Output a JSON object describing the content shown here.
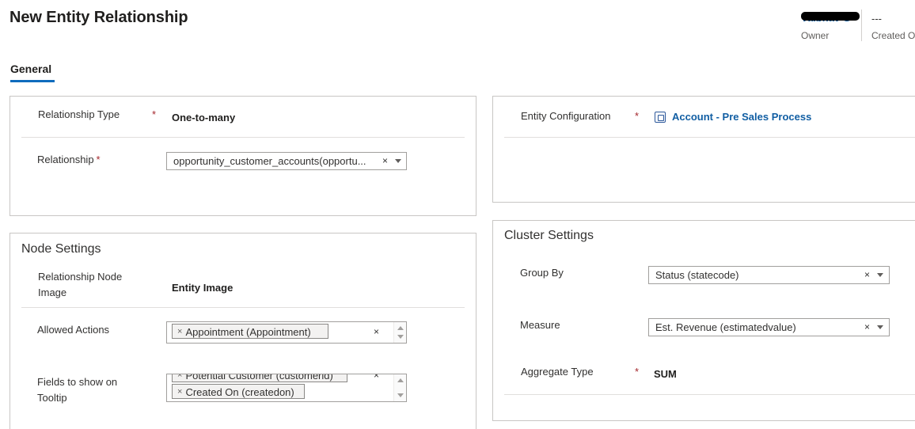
{
  "page": {
    "title": "New Entity Relationship"
  },
  "header_fields": {
    "owner": {
      "value": "Vaibhav G",
      "label": "Owner"
    },
    "created_on": {
      "value": "---",
      "label": "Created On"
    }
  },
  "tabs": [
    {
      "label": "General",
      "selected": true
    }
  ],
  "general": {
    "relationship_type": {
      "label": "Relationship Type",
      "required": "*",
      "value": "One-to-many"
    },
    "relationship": {
      "label": "Relationship",
      "required": "*",
      "value": "opportunity_customer_accounts(opportu...",
      "clear": "×"
    },
    "entity_configuration": {
      "label": "Entity Configuration",
      "required": "*",
      "value": "Account - Pre Sales Process",
      "icon": "entity-icon"
    }
  },
  "node_settings": {
    "title": "Node Settings",
    "relationship_node_image": {
      "label": "Relationship Node Image",
      "value": "Entity Image"
    },
    "allowed_actions": {
      "label": "Allowed Actions",
      "items": [
        "Appointment (Appointment)"
      ],
      "clear": "×"
    },
    "fields_to_show_on_tooltip": {
      "label": "Fields to show on Tooltip",
      "items": [
        "Potential Customer (customerid)",
        "Created On (createdon)"
      ],
      "clear": "×"
    }
  },
  "cluster_settings": {
    "title": "Cluster Settings",
    "group_by": {
      "label": "Group By",
      "value": "Status (statecode)",
      "clear": "×"
    },
    "measure": {
      "label": "Measure",
      "value": "Est. Revenue (estimatedvalue)",
      "clear": "×"
    },
    "aggregate_type": {
      "label": "Aggregate Type",
      "required": "*",
      "value": "SUM"
    }
  },
  "colors": {
    "accent": "#0f6cbd",
    "link": "#115ea3",
    "required": "#a4262c",
    "border": "#c8c6c4"
  }
}
